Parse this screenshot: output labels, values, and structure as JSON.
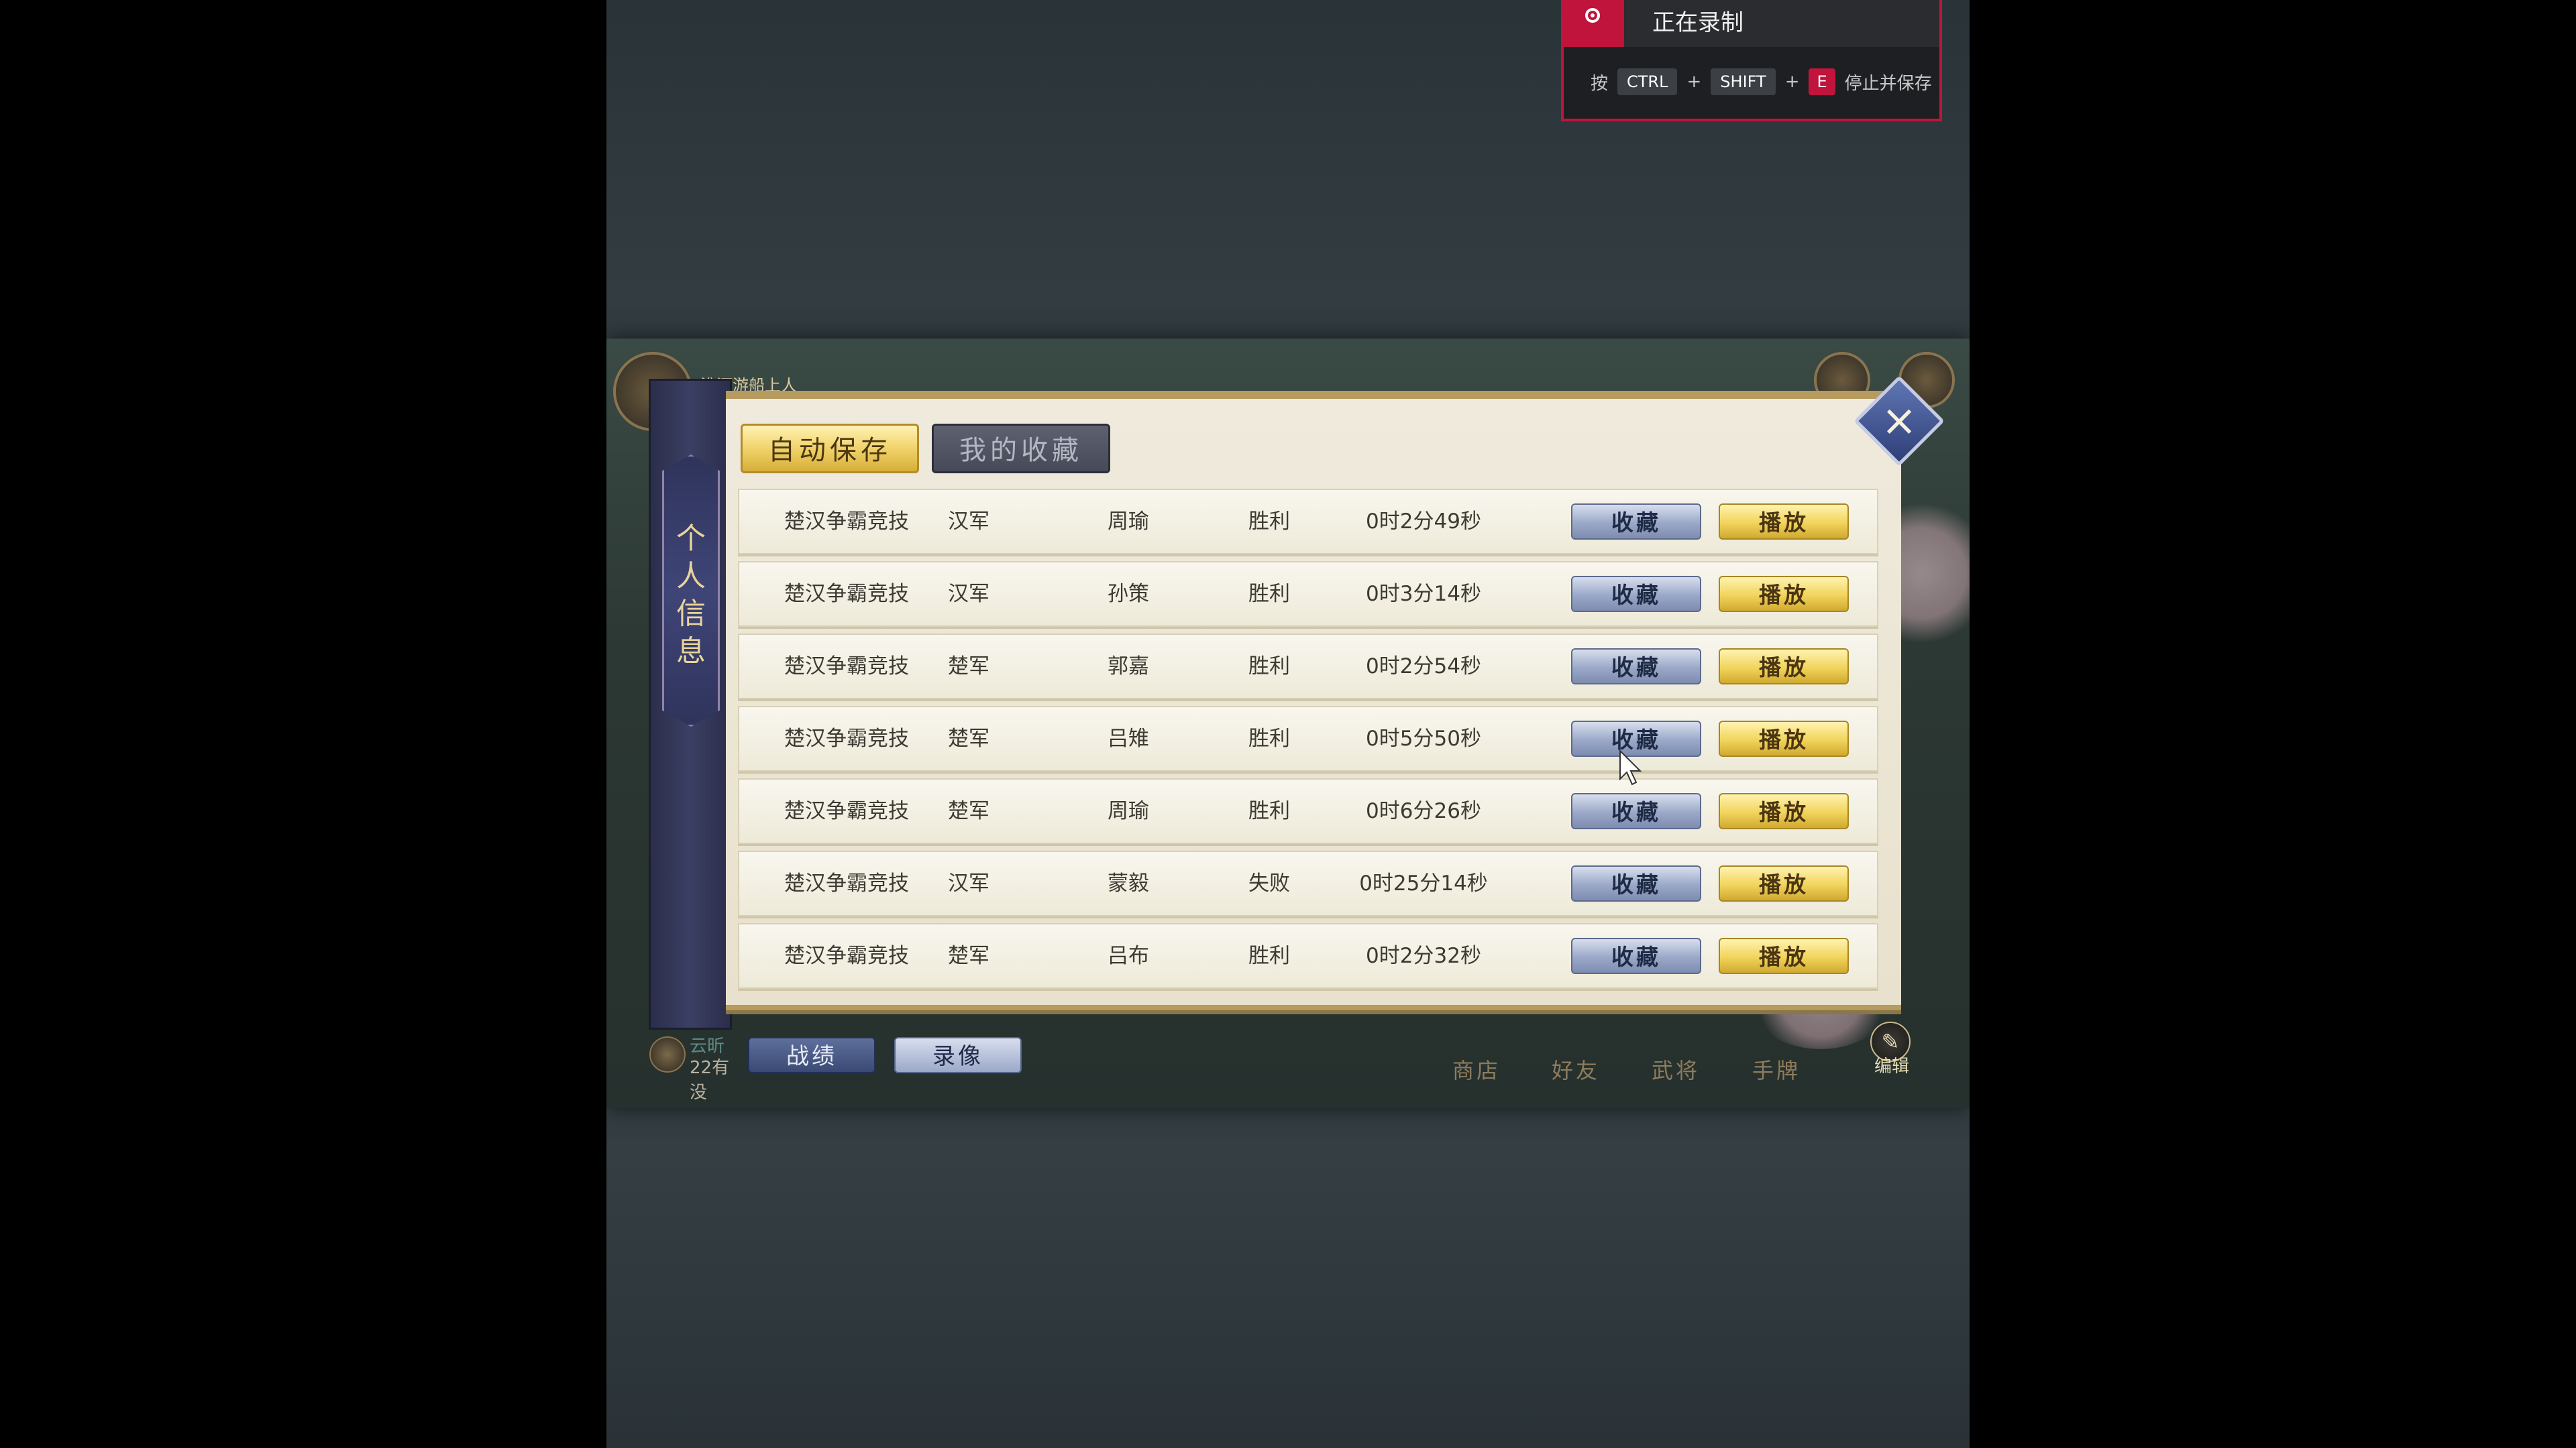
{
  "recorder": {
    "status": "正在录制",
    "hint_prefix": "按",
    "key1": "CTRL",
    "plus1": "+",
    "key2": "SHIFT",
    "plus2": "+",
    "key3": "E",
    "hint_suffix": "停止并保存",
    "accent_color": "#c0143c"
  },
  "top_hud": {
    "location_text": "淮河游船上人"
  },
  "side_panel": {
    "title": "个\n人\n信\n息"
  },
  "tabs": {
    "active": "自动保存",
    "inactive": "我的收藏"
  },
  "rows": [
    {
      "mode": "楚汉争霸竞技",
      "side": "汉军",
      "hero": "周瑜",
      "result": "胜利",
      "duration": "0时2分49秒",
      "fav": "收藏",
      "play": "播放"
    },
    {
      "mode": "楚汉争霸竞技",
      "side": "汉军",
      "hero": "孙策",
      "result": "胜利",
      "duration": "0时3分14秒",
      "fav": "收藏",
      "play": "播放"
    },
    {
      "mode": "楚汉争霸竞技",
      "side": "楚军",
      "hero": "郭嘉",
      "result": "胜利",
      "duration": "0时2分54秒",
      "fav": "收藏",
      "play": "播放"
    },
    {
      "mode": "楚汉争霸竞技",
      "side": "楚军",
      "hero": "吕雉",
      "result": "胜利",
      "duration": "0时5分50秒",
      "fav": "收藏",
      "play": "播放"
    },
    {
      "mode": "楚汉争霸竞技",
      "side": "楚军",
      "hero": "周瑜",
      "result": "胜利",
      "duration": "0时6分26秒",
      "fav": "收藏",
      "play": "播放"
    },
    {
      "mode": "楚汉争霸竞技",
      "side": "汉军",
      "hero": "蒙毅",
      "result": "失败",
      "duration": "0时25分14秒",
      "fav": "收藏",
      "play": "播放"
    },
    {
      "mode": "楚汉争霸竞技",
      "side": "楚军",
      "hero": "吕布",
      "result": "胜利",
      "duration": "0时2分32秒",
      "fav": "收藏",
      "play": "播放"
    }
  ],
  "close_icon": "×",
  "bottom": {
    "player_name": "云昕",
    "player_status": "22有没",
    "record_tab": "战绩",
    "replay_tab": "录像",
    "nav": [
      "商店",
      "好友",
      "武将",
      "手牌"
    ],
    "edit_label": "编辑"
  }
}
